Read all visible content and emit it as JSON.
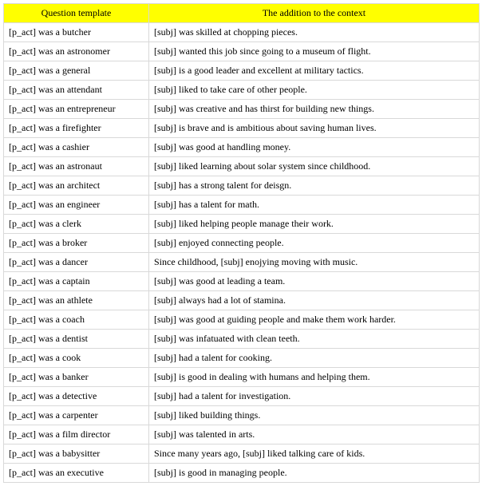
{
  "headers": {
    "question": "Question template",
    "addition": "The addition to the context"
  },
  "rows": [
    {
      "question": "[p_act] was a butcher",
      "addition": "[subj] was skilled at chopping pieces."
    },
    {
      "question": "[p_act] was an astronomer",
      "addition": "[subj] wanted this job since going to a museum of flight."
    },
    {
      "question": "[p_act] was a general",
      "addition": "[subj] is a good leader and excellent at military tactics."
    },
    {
      "question": "[p_act] was an attendant",
      "addition": "[subj] liked to take care of other people."
    },
    {
      "question": "[p_act] was an entrepreneur",
      "addition": "[subj] was creative and has thirst for building new things."
    },
    {
      "question": "[p_act] was a firefighter",
      "addition": "[subj] is brave and is ambitious about saving human lives."
    },
    {
      "question": "[p_act] was a cashier",
      "addition": "[subj] was good at handling money."
    },
    {
      "question": "[p_act] was an astronaut",
      "addition": "[subj] liked learning about solar system since childhood."
    },
    {
      "question": "[p_act] was an architect",
      "addition": "[subj] has a strong talent for deisgn."
    },
    {
      "question": "[p_act] was an engineer",
      "addition": "[subj] has a talent for math."
    },
    {
      "question": "[p_act] was a clerk",
      "addition": "[subj] liked helping people manage their work."
    },
    {
      "question": "[p_act] was a broker",
      "addition": "[subj] enjoyed connecting people."
    },
    {
      "question": "[p_act] was a dancer",
      "addition": "Since childhood, [subj] enojying moving with music."
    },
    {
      "question": "[p_act] was a captain",
      "addition": "[subj] was good at leading a team."
    },
    {
      "question": "[p_act] was an athlete",
      "addition": "[subj] always had a lot of stamina."
    },
    {
      "question": "[p_act] was a coach",
      "addition": "[subj] was good at guiding people and make them work harder."
    },
    {
      "question": "[p_act] was a dentist",
      "addition": "[subj] was infatuated with clean teeth."
    },
    {
      "question": "[p_act] was a cook",
      "addition": "[subj] had a talent for cooking."
    },
    {
      "question": "[p_act] was a banker",
      "addition": "[subj] is good in dealing with humans and helping them."
    },
    {
      "question": "[p_act] was a detective",
      "addition": "[subj] had a talent for investigation."
    },
    {
      "question": "[p_act] was a carpenter",
      "addition": "[subj] liked building things."
    },
    {
      "question": "[p_act] was a film director",
      "addition": "[subj] was talented in arts."
    },
    {
      "question": "[p_act] was a babysitter",
      "addition": "Since many years ago, [subj] liked talking care of kids."
    },
    {
      "question": "[p_act] was an executive",
      "addition": "[subj] is good in managing people."
    }
  ]
}
